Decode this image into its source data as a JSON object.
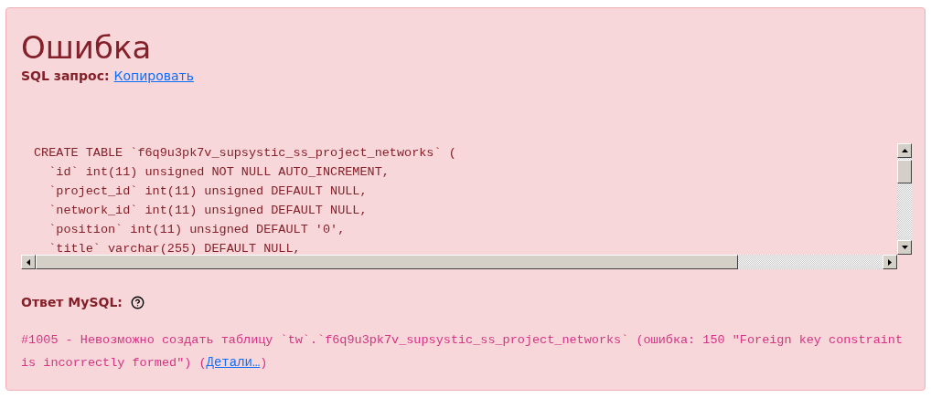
{
  "title": "Ошибка",
  "sql_label": "SQL запрос:",
  "copy_link": "Копировать",
  "code_lines": [
    "CREATE TABLE `f6q9u3pk7v_supsystic_ss_project_networks` (",
    "  `id` int(11) unsigned NOT NULL AUTO_INCREMENT,",
    "  `project_id` int(11) unsigned DEFAULT NULL,",
    "  `network_id` int(11) unsigned DEFAULT NULL,",
    "  `position` int(11) unsigned DEFAULT '0',",
    "  `title` varchar(255) DEFAULT NULL,"
  ],
  "response_label": "Ответ MySQL:",
  "error": {
    "text": "#1005 - Невозможно создать таблицу `tw`.`f6q9u3pk7v_supsystic_ss_project_networks` (ошибка: 150 \"Foreign key constraint is incorrectly formed\") (",
    "link": "Детали…",
    "after": ")"
  }
}
